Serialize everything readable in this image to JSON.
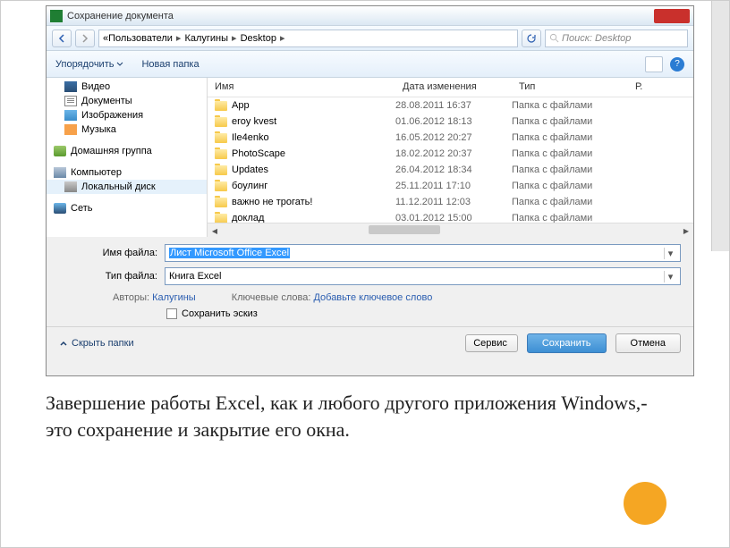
{
  "titlebar": {
    "title": "Сохранение документа"
  },
  "breadcrumb": {
    "sep1": "«",
    "p1": "Пользователи",
    "p2": "Калугины",
    "p3": "Desktop",
    "sep": "▸"
  },
  "search": {
    "placeholder": "Поиск: Desktop"
  },
  "toolbar": {
    "organize": "Упорядочить",
    "newfolder": "Новая папка"
  },
  "sidebar": {
    "items": [
      {
        "label": "Видео"
      },
      {
        "label": "Документы"
      },
      {
        "label": "Изображения"
      },
      {
        "label": "Музыка"
      },
      {
        "label": "Домашняя группа"
      },
      {
        "label": "Компьютер"
      },
      {
        "label": "Локальный диск"
      },
      {
        "label": "Сеть"
      }
    ]
  },
  "columns": {
    "name": "Имя",
    "date": "Дата изменения",
    "type": "Тип",
    "size": "Р."
  },
  "files": [
    {
      "name": "App",
      "date": "28.08.2011 16:37",
      "type": "Папка с файлами"
    },
    {
      "name": "eroy kvest",
      "date": "01.06.2012 18:13",
      "type": "Папка с файлами"
    },
    {
      "name": "Ile4enko",
      "date": "16.05.2012 20:27",
      "type": "Папка с файлами"
    },
    {
      "name": "PhotoScape",
      "date": "18.02.2012 20:37",
      "type": "Папка с файлами"
    },
    {
      "name": "Updates",
      "date": "26.04.2012 18:34",
      "type": "Папка с файлами"
    },
    {
      "name": "боулинг",
      "date": "25.11.2011 17:10",
      "type": "Папка с файлами"
    },
    {
      "name": "важно не трогать!",
      "date": "11.12.2011 12:03",
      "type": "Папка с файлами"
    },
    {
      "name": "доклад",
      "date": "03.01.2012 15:00",
      "type": "Папка с файлами"
    }
  ],
  "form": {
    "filename_label": "Имя файла:",
    "filename_value": "Лист Microsoft Office Excel",
    "filetype_label": "Тип файла:",
    "filetype_value": "Книга Excel",
    "authors_label": "Авторы:",
    "authors_value": "Калугины",
    "keywords_label": "Ключевые слова:",
    "keywords_value": "Добавьте ключевое слово",
    "thumb_label": "Сохранить эскиз"
  },
  "footer": {
    "hide": "Скрыть папки",
    "service": "Сервис",
    "save": "Сохранить",
    "cancel": "Отмена"
  },
  "caption": " Завершение работы Excel, как и любого другого приложения Windows,- это сохранение и закрытие его окна."
}
